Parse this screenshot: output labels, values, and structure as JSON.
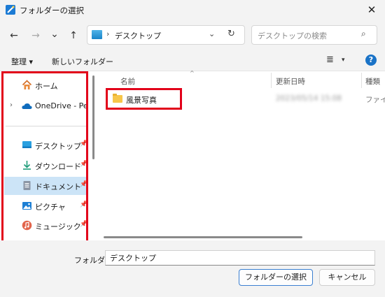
{
  "window": {
    "title": "フォルダーの選択",
    "close_glyph": "✕"
  },
  "nav": {
    "back_glyph": "←",
    "forward_glyph": "→",
    "recent_glyph": "⌄",
    "up_glyph": "↑"
  },
  "address": {
    "separator_glyph": "›",
    "path": "デスクトップ",
    "dropdown_glyph": "⌄",
    "refresh_glyph": "↻"
  },
  "search": {
    "placeholder": "デスクトップの検索",
    "icon_glyph": "⌕"
  },
  "toolbar": {
    "organize_label": "整理 ▾",
    "new_folder_label": "新しいフォルダー",
    "view_glyph": "≣",
    "view_dropdown_glyph": "▾",
    "help_label": "?"
  },
  "sidebar": {
    "items": [
      {
        "label": "ホーム",
        "icon": "home-icon"
      },
      {
        "label": "OneDrive - Pers",
        "icon": "onedrive-icon",
        "expand_glyph": "›"
      },
      {
        "label": "デスクトップ",
        "icon": "desktop-icon",
        "pin_glyph": "📌"
      },
      {
        "label": "ダウンロード",
        "icon": "download-icon",
        "pin_glyph": "📌"
      },
      {
        "label": "ドキュメント",
        "icon": "documents-icon",
        "pin_glyph": "📌",
        "selected": true
      },
      {
        "label": "ピクチャ",
        "icon": "pictures-icon",
        "pin_glyph": "📌"
      },
      {
        "label": "ミュージック",
        "icon": "music-icon",
        "pin_glyph": "📌"
      }
    ]
  },
  "columns": {
    "name": "名前",
    "date": "更新日時",
    "type": "種類",
    "sort_glyph": "^"
  },
  "files": [
    {
      "name": "風景写真",
      "date": "2023/05/14 15:08",
      "type": "ファイル"
    }
  ],
  "footer": {
    "folder_label": "フォルダー:",
    "folder_value": "デスクトップ",
    "select_button": "フォルダーの選択",
    "cancel_button": "キャンセル"
  },
  "colors": {
    "highlight_red": "#e2001a",
    "selection_blue": "#cce4f7",
    "accent_blue": "#1a73c7"
  }
}
